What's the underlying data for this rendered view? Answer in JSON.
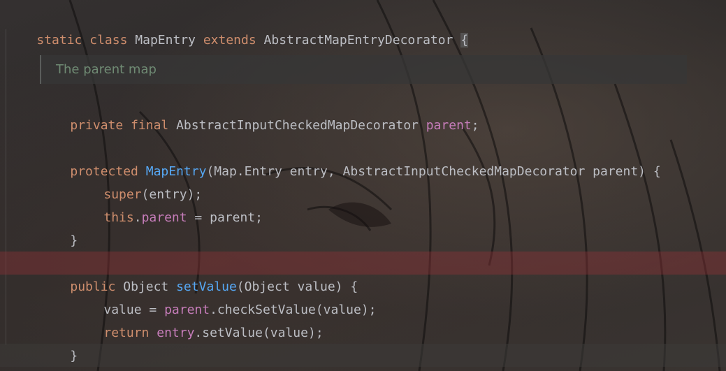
{
  "editor": {
    "accent_colors": {
      "keyword": "#cf8e6d",
      "method": "#56a8f5",
      "field": "#c77dbb",
      "text": "#bcbec4",
      "doc_comment": "#6f8a73",
      "error_line": "#963237"
    },
    "line1": {
      "kw1": "static",
      "kw2": "class",
      "name": "MapEntry",
      "kw3": "extends",
      "super_type": "AbstractMapEntryDecorator",
      "brace": "{"
    },
    "doc_comment": "The parent map",
    "field_decl": {
      "kw1": "private",
      "kw2": "final",
      "type": "AbstractInputCheckedMapDecorator",
      "name": "parent",
      "end": ";"
    },
    "ctor_sig": {
      "kw": "protected",
      "name": "MapEntry",
      "params": "(Map.Entry entry, AbstractInputCheckedMapDecorator parent) {"
    },
    "ctor_super": {
      "kw": "super",
      "rest": "(entry);"
    },
    "ctor_assign": {
      "kw": "this",
      "dot": ".",
      "field": "parent",
      "rest": " = parent;"
    },
    "ctor_close": "}",
    "set_sig": {
      "kw": "public",
      "type": " Object ",
      "name": "setValue",
      "params": "(Object value) {"
    },
    "set_body1": {
      "lhs": "value = ",
      "field": "parent",
      "rest": ".checkSetValue(value);"
    },
    "set_body2": {
      "kw": "return",
      "field": "entry",
      "rest": ".setValue(value);"
    },
    "set_close": "}",
    "class_close": "}"
  }
}
